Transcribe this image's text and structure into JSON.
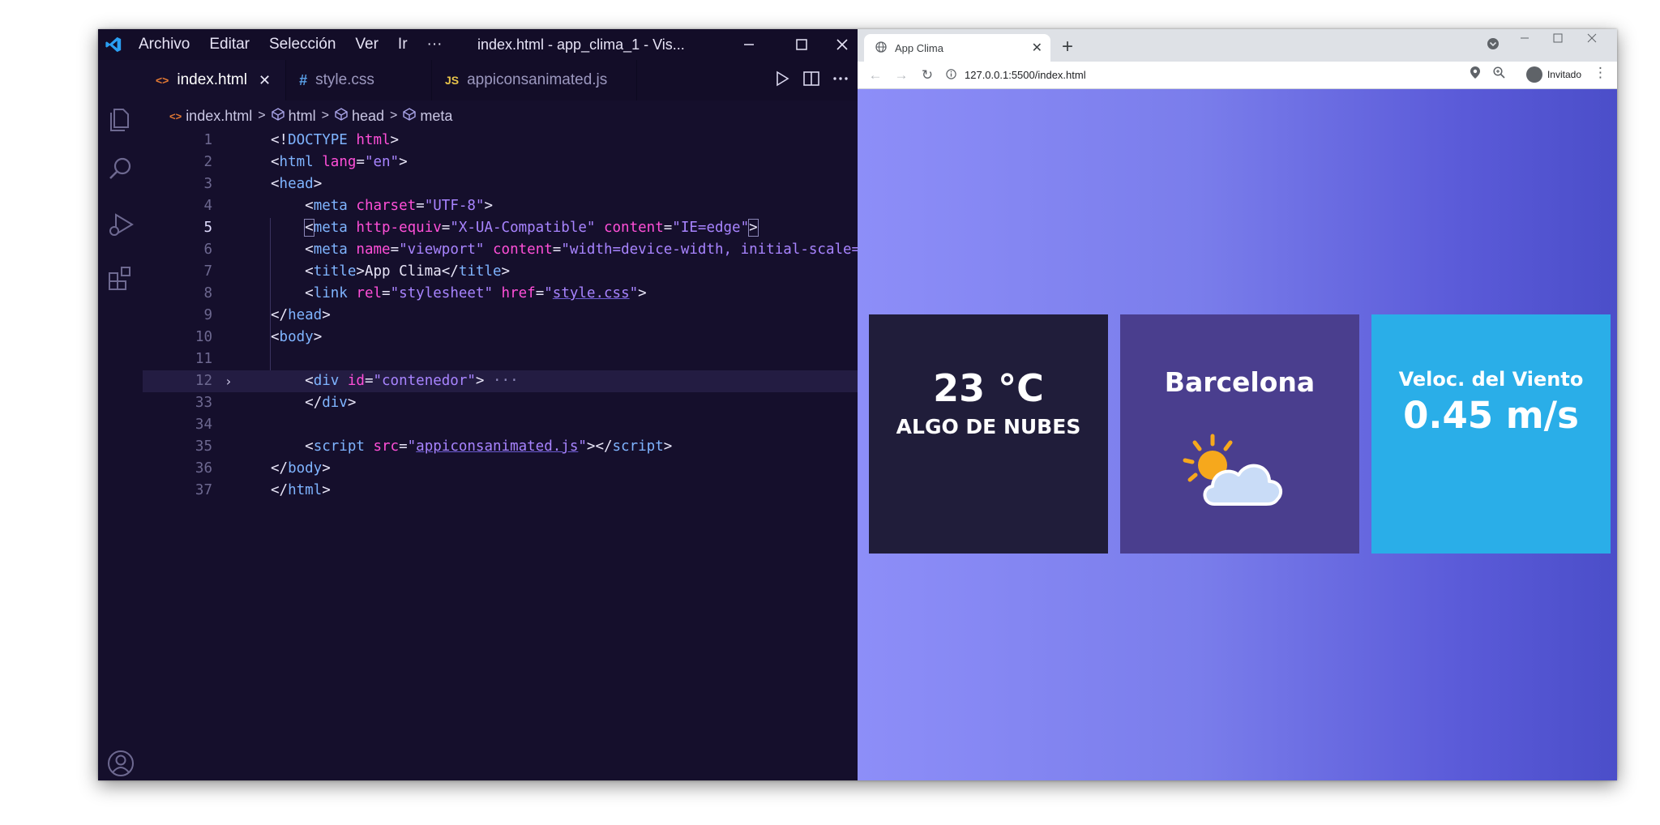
{
  "vscode": {
    "menu": [
      "Archivo",
      "Editar",
      "Selección",
      "Ver",
      "Ir",
      "···"
    ],
    "window_title": "index.html - app_clima_1 - Vis...",
    "tabs": [
      {
        "badge": "<>",
        "label": "index.html",
        "close": "✕"
      },
      {
        "badge": "#",
        "label": "style.css"
      },
      {
        "badge": "JS",
        "label": "appiconsanimated.js"
      }
    ],
    "breadcrumb": [
      "index.html",
      "html",
      "head",
      "meta"
    ],
    "line_numbers": [
      "1",
      "2",
      "3",
      "4",
      "5",
      "6",
      "7",
      "8",
      "9",
      "10",
      "11",
      "12",
      "33",
      "34",
      "35",
      "36",
      "37"
    ]
  },
  "browser": {
    "tab_title": "App Clima",
    "tab_close": "✕",
    "new_tab": "+",
    "url": "127.0.0.1:5500/index.html",
    "profile_label": "Invitado"
  },
  "weather": {
    "temperature": "23 °C",
    "description": "ALGO DE NUBES",
    "city": "Barcelona",
    "wind_label": "Veloc. del Viento",
    "wind_value": "0.45 m/s",
    "icon": "partly-cloudy-icon"
  },
  "colors": {
    "editor_bg": "#150f2c",
    "tag": "#7fb4ff",
    "attr": "#ff4fd8",
    "string": "#a884ff",
    "card_temp": "#201d3a",
    "card_city": "#4a3e8e",
    "card_wind": "#2aaee8"
  }
}
